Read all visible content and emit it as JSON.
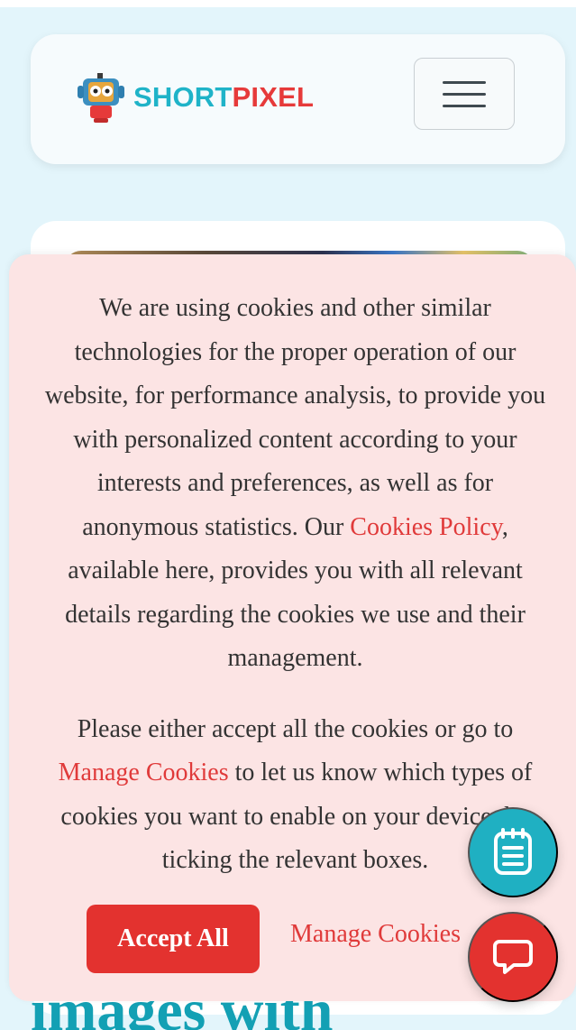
{
  "header": {
    "logo": {
      "short": "SHORT",
      "pixel": "PIXEL"
    },
    "menu_icon": "hamburger-menu-icon"
  },
  "hero": {
    "heading_partial": "images with"
  },
  "cookie_banner": {
    "para1_before_link": "We are using cookies and other similar technologies for the proper operation of our website, for performance analysis, to provide you with personalized content according to your interests and preferences, as well as for anonymous statistics. Our ",
    "policy_link": "Cookies Policy",
    "para1_after_link": ", available here, provides you with all relevant details regarding the cookies we use and their management.",
    "para2_before_link": "Please either accept all the cookies or go to ",
    "manage_link_inline": "Manage Cookies",
    "para2_after_link": " to let us know which types of cookies you want to enable on your device, by ticking the relevant boxes.",
    "accept_label": "Accept All",
    "manage_label": "Manage Cookies"
  },
  "floating_buttons": {
    "notes_icon": "notepad-icon",
    "chat_icon": "chat-bubble-icon"
  },
  "colors": {
    "brand_teal": "#1fb3c8",
    "brand_red": "#e63a3a",
    "banner_bg": "#fce4e4",
    "accept_bg": "#e3322f"
  }
}
